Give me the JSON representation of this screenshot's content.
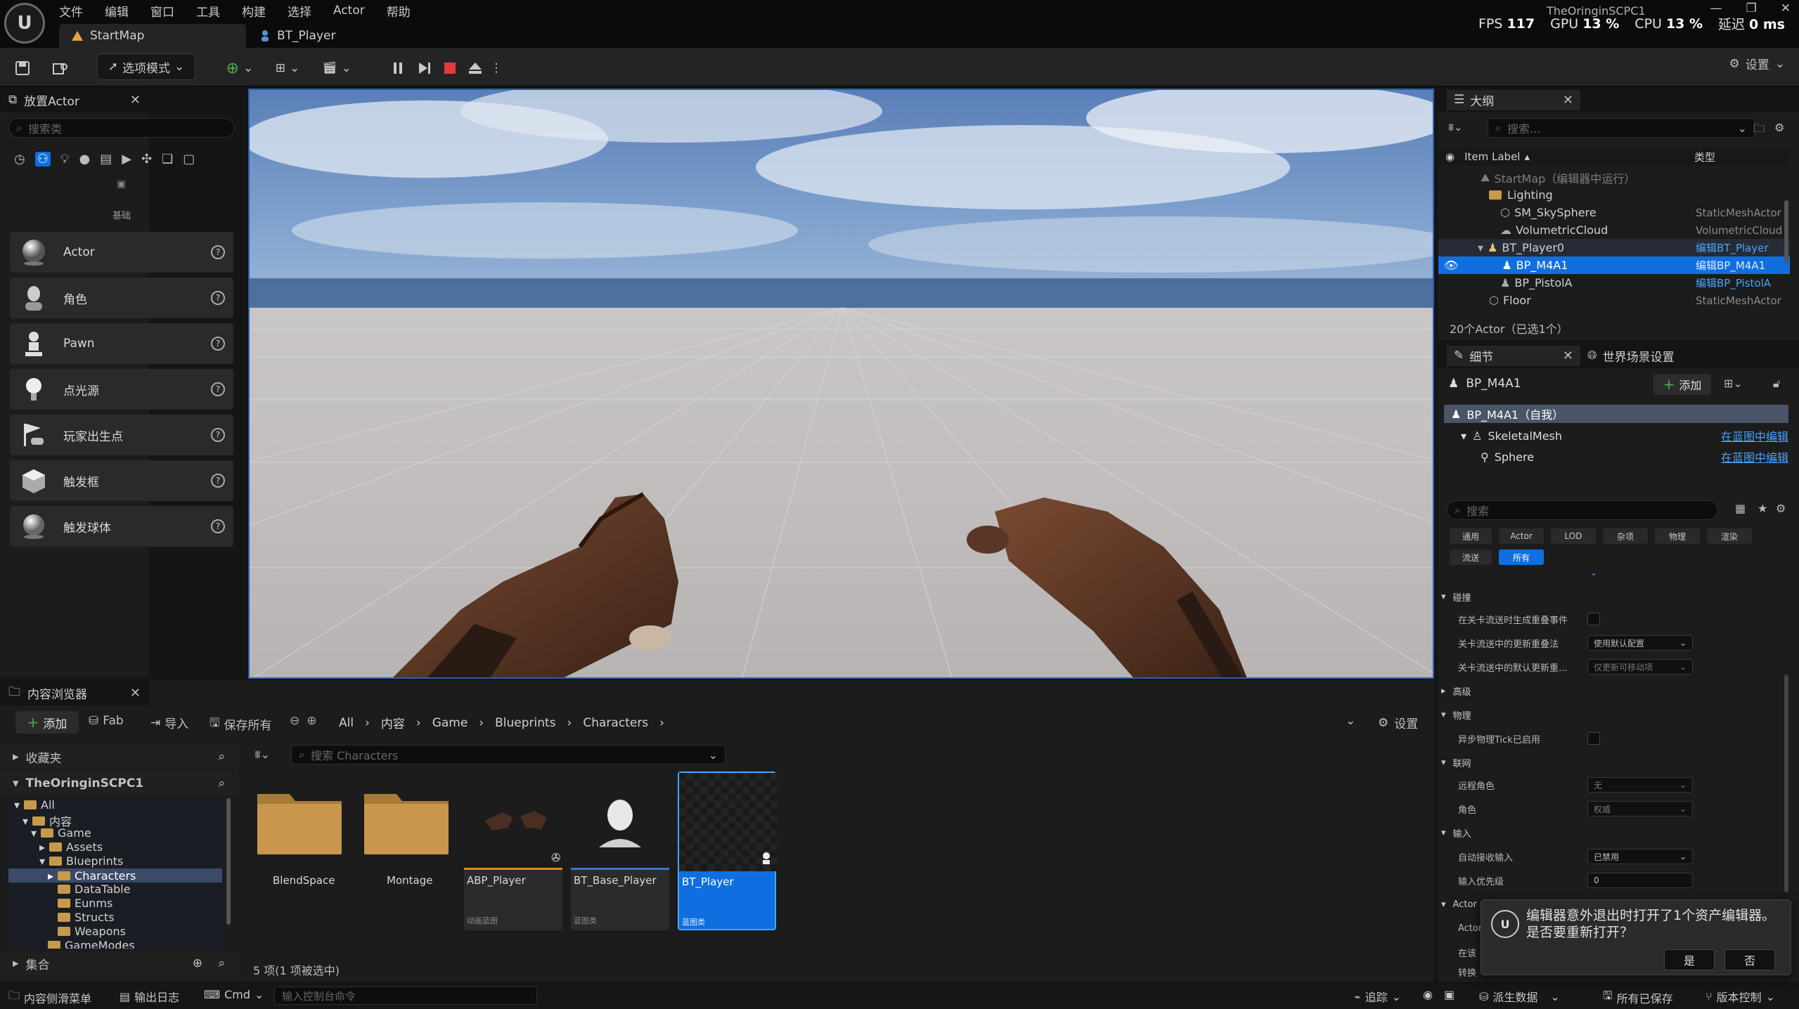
{
  "menu": [
    "文件",
    "编辑",
    "窗口",
    "工具",
    "构建",
    "选择",
    "Actor",
    "帮助"
  ],
  "tabs": {
    "main": "StartMap",
    "secondary": "BT_Player"
  },
  "project_name": "TheOringinSCPC1",
  "perf": {
    "fps_label": "FPS",
    "fps": "117",
    "gpu_label": "GPU",
    "gpu": "13 %",
    "cpu_label": "CPU",
    "cpu": "13 %",
    "latency_label": "延迟",
    "latency": "0 ms"
  },
  "toolbar": {
    "mode": "选项模式",
    "settings": "设置"
  },
  "place_actor": {
    "title": "放置Actor",
    "search_placeholder": "搜索类",
    "category": "基础",
    "items": [
      {
        "label": "Actor"
      },
      {
        "label": "角色"
      },
      {
        "label": "Pawn"
      },
      {
        "label": "点光源"
      },
      {
        "label": "玩家出生点"
      },
      {
        "label": "触发框"
      },
      {
        "label": "触发球体"
      }
    ]
  },
  "outliner": {
    "title": "大纲",
    "search_placeholder": "搜索...",
    "col_label": "Item Label",
    "col_type": "类型",
    "rows": [
      {
        "label": "StartMap（编辑器中运行）",
        "type": ""
      },
      {
        "label": "Lighting",
        "type": ""
      },
      {
        "label": "SM_SkySphere",
        "type": "StaticMeshActor"
      },
      {
        "label": "VolumetricCloud",
        "type": "VolumetricCloud"
      },
      {
        "label": "BT_Player0",
        "type": "编辑BT_Player"
      },
      {
        "label": "BP_M4A1",
        "type": "编辑BP_M4A1"
      },
      {
        "label": "BP_PistolA",
        "type": "编辑BP_PistolA"
      },
      {
        "label": "Floor",
        "type": "StaticMeshActor"
      }
    ],
    "footer": "20个Actor（已选1个）"
  },
  "details": {
    "tab_details": "细节",
    "tab_world": "世界场景设置",
    "object_name": "BP_M4A1",
    "add_label": "添加",
    "components": [
      {
        "label": "BP_M4A1（自我）",
        "link": ""
      },
      {
        "label": "SkeletalMesh",
        "link": "在蓝图中编辑"
      },
      {
        "label": "Sphere",
        "link": "在蓝图中编辑"
      }
    ],
    "search_placeholder": "搜索",
    "filters": [
      "通用",
      "Actor",
      "LOD",
      "杂项",
      "物理",
      "渲染",
      "流送",
      "所有"
    ],
    "cat_collision": "碰撞",
    "prop_gen_overlap": "在关卡流送时生成重叠事件",
    "prop_update_method": "关卡流送中的更新重叠法",
    "prop_update_method_val": "使用默认配置",
    "prop_default_update": "关卡流送中的默认更新重...",
    "prop_default_update_val": "仅更新可移动项",
    "cat_advanced": "高级",
    "cat_physics": "物理",
    "prop_async_tick": "异步物理Tick已启用",
    "cat_network": "联网",
    "prop_remote_role": "远程角色",
    "prop_remote_role_val": "无",
    "prop_role": "角色",
    "prop_role_val": "权威",
    "cat_input": "输入",
    "prop_auto_input": "自动接收输入",
    "prop_auto_input_val": "已禁用",
    "prop_input_priority": "输入优先级",
    "prop_input_priority_val": "0",
    "cat_actor": "Actor",
    "prop_actor_1": "Actor",
    "prop_actor_2": "在该",
    "prop_actor_3": "转换"
  },
  "content_browser": {
    "title": "内容浏览器",
    "add": "添加",
    "fab": "Fab",
    "import": "导入",
    "save_all": "保存所有",
    "breadcrumbs": [
      "All",
      "内容",
      "Game",
      "Blueprints",
      "Characters"
    ],
    "settings": "设置",
    "favorites": "收藏夹",
    "project": "TheOringinSCPC1",
    "tree": [
      "All",
      "内容",
      "Game",
      "Assets",
      "Blueprints",
      "Characters",
      "DataTable",
      "Eunms",
      "Structs",
      "Weapons",
      "GameModes"
    ],
    "collections": "集合",
    "search_placeholder": "搜索 Characters",
    "assets": [
      {
        "name": "BlendSpace",
        "sub": ""
      },
      {
        "name": "Montage",
        "sub": ""
      },
      {
        "name": "ABP_Player",
        "sub": "动画蓝图"
      },
      {
        "name": "BT_Base_Player",
        "sub": "蓝图类"
      },
      {
        "name": "BT_Player",
        "sub": "蓝图类"
      }
    ],
    "status": "5 项(1 项被选中)"
  },
  "statusbar": {
    "drawer": "内容侧滑菜单",
    "output_log": "输出日志",
    "cmd": "Cmd",
    "console_placeholder": "输入控制台命令",
    "trace": "追踪",
    "derived_data": "派生数据",
    "all_saved": "所有已保存",
    "source_control": "版本控制"
  },
  "notification": {
    "message": "编辑器意外退出时打开了1个资产编辑器。是否要重新打开？",
    "yes": "是",
    "no": "否"
  },
  "colors": {
    "accent": "#0f6fe0",
    "link": "#4aa3ff",
    "folder": "#c79a4b",
    "stop": "#e33b3b"
  }
}
